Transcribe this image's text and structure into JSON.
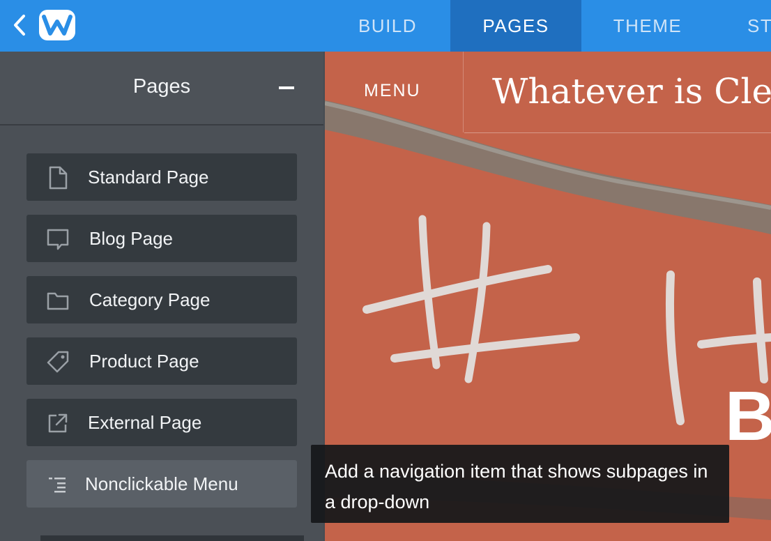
{
  "topbar": {
    "tabs": [
      {
        "label": "BUILD"
      },
      {
        "label": "PAGES"
      },
      {
        "label": "THEME"
      },
      {
        "label": "ST"
      }
    ],
    "active_tab": "PAGES",
    "colors": {
      "bar": "#2a8ee6",
      "active": "#1f6fbf"
    }
  },
  "sidebar": {
    "title": "Pages",
    "items": [
      {
        "label": "Standard Page",
        "icon": "document-icon"
      },
      {
        "label": "Blog Page",
        "icon": "speech-bubble-icon"
      },
      {
        "label": "Category Page",
        "icon": "folder-icon"
      },
      {
        "label": "Product Page",
        "icon": "tag-icon"
      },
      {
        "label": "External Page",
        "icon": "external-link-icon"
      },
      {
        "label": "Nonclickable Menu",
        "icon": "indented-list-icon"
      }
    ]
  },
  "preview": {
    "menu_label": "MENU",
    "site_title": "Whatever is Cle",
    "big_letter": "B"
  },
  "tooltip": {
    "text": "Add a navigation item that shows subpages in a drop-down"
  }
}
